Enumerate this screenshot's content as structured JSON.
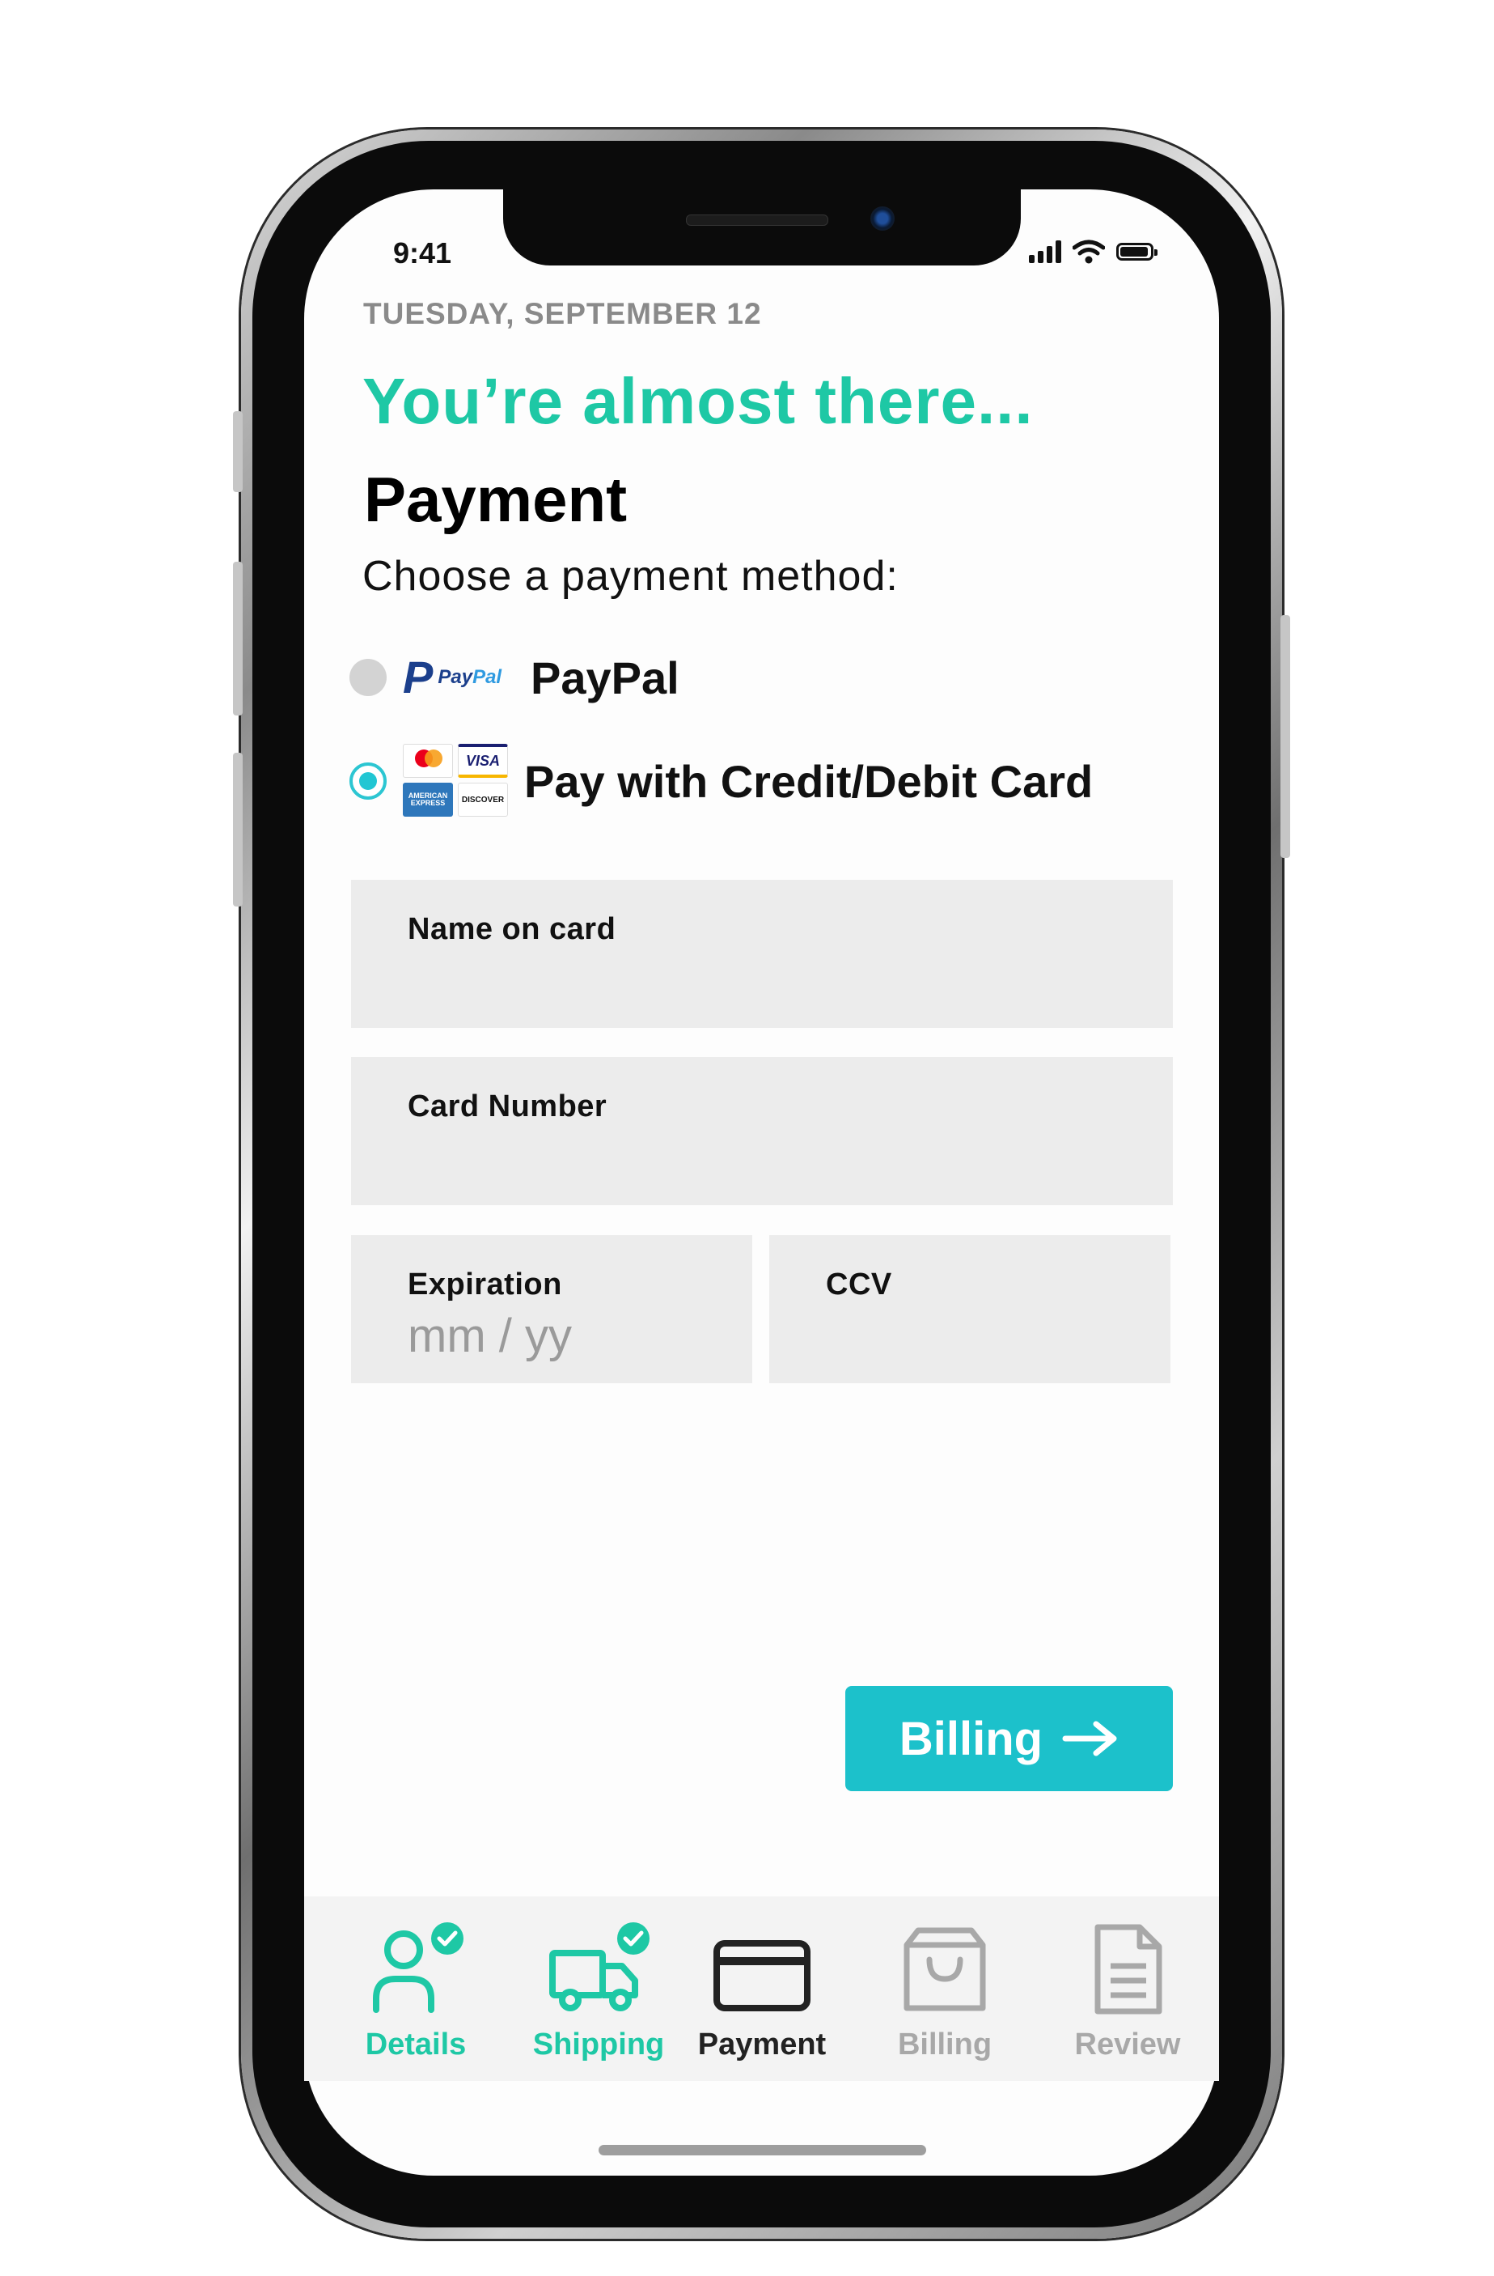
{
  "status_bar": {
    "time": "9:41"
  },
  "header": {
    "date": "TUESDAY, SEPTEMBER 12",
    "headline": "You’re almost there...",
    "title": "Payment",
    "subtitle": "Choose a payment method:"
  },
  "payment_options": [
    {
      "label": "PayPal",
      "selected": false,
      "logo_main": "P",
      "logo_text_a": "Pay",
      "logo_text_b": "Pal"
    },
    {
      "label": "Pay with Credit/Debit Card",
      "selected": true,
      "card_logos": [
        "mastercard",
        "VISA",
        "AMERICAN EXPRESS",
        "DISCOVER"
      ]
    }
  ],
  "form": {
    "name_label": "Name on card",
    "card_number_label": "Card Number",
    "expiration_label": "Expiration",
    "expiration_placeholder": "mm / yy",
    "ccv_label": "CCV"
  },
  "next_button": {
    "label": "Billing",
    "icon": "arrow-right-icon"
  },
  "tabs": [
    {
      "label": "Details",
      "icon": "person-icon",
      "state": "complete"
    },
    {
      "label": "Shipping",
      "icon": "truck-icon",
      "state": "complete"
    },
    {
      "label": "Payment",
      "icon": "credit-card-icon",
      "state": "current"
    },
    {
      "label": "Billing",
      "icon": "shopping-bag-icon",
      "state": "upcoming"
    },
    {
      "label": "Review",
      "icon": "document-icon",
      "state": "upcoming"
    }
  ],
  "colors": {
    "accent_green": "#1ec8a5",
    "accent_teal": "#1cc1cb",
    "radio_selected": "#21c6d3",
    "field_bg": "#ececec",
    "tab_upcoming": "#a8a8a8",
    "tab_current": "#222222"
  }
}
